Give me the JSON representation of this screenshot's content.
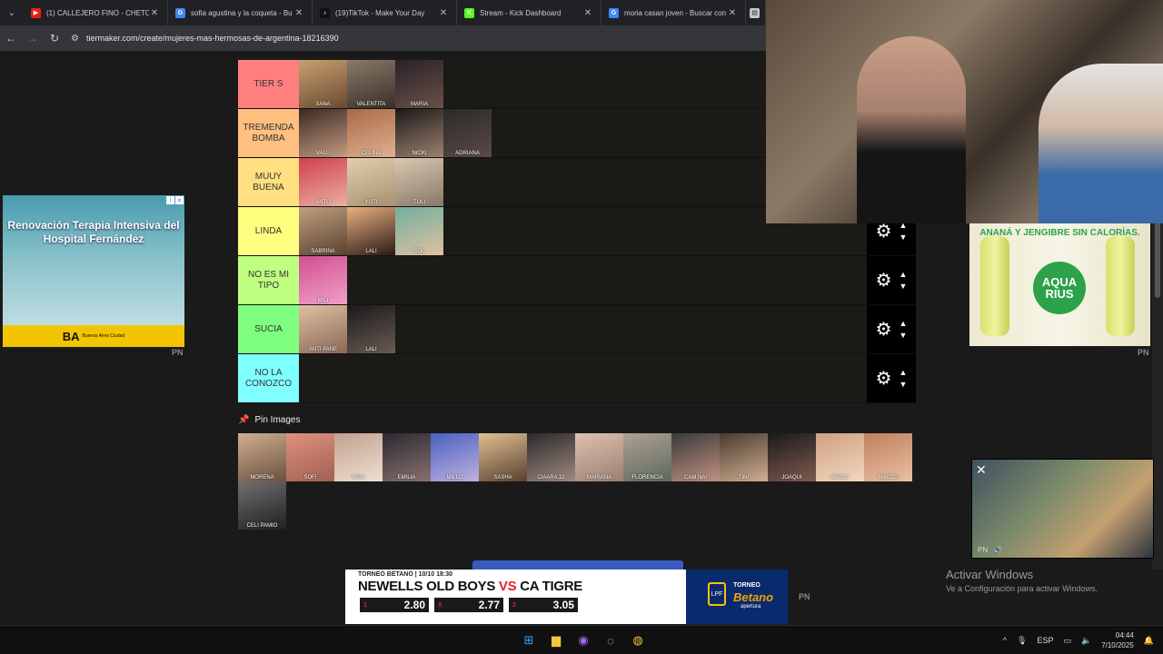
{
  "browser": {
    "tabs": [
      {
        "title": "(1) CALLEJERO FINO - CHETO",
        "color": "#e62117",
        "glyph": "▶"
      },
      {
        "title": "sofia agustina y la coqueta - Bu",
        "color": "#4285f4",
        "glyph": "G"
      },
      {
        "title": "(19)TikTok - Make Your Day",
        "color": "#111111",
        "glyph": "♪"
      },
      {
        "title": "Stream - Kick Dashboard",
        "color": "#53fc18",
        "glyph": "K"
      },
      {
        "title": "moria casan joven - Buscar con",
        "color": "#4285f4",
        "glyph": "G"
      }
    ],
    "url": "tiermaker.com/create/mujeres-mas-hermosas-de-argentina-18216390"
  },
  "tiers": [
    {
      "label": "TIER S",
      "color": "#ff7f7f",
      "items": [
        {
          "cap": "SANA",
          "c1": "#c8a070",
          "c2": "#6a4a30"
        },
        {
          "cap": "VALENTITA",
          "c1": "#8a7a6a",
          "c2": "#3a2e28"
        },
        {
          "cap": "MARIA",
          "c1": "#2a2228",
          "c2": "#6a5048"
        }
      ]
    },
    {
      "label": "TREMENDA BOMBA",
      "color": "#ffbf7f",
      "items": [
        {
          "cap": "VALU",
          "c1": "#3a2a24",
          "c2": "#c49a80"
        },
        {
          "cap": "CELINA",
          "c1": "#a86a48",
          "c2": "#e0b090"
        },
        {
          "cap": "NICKI",
          "c1": "#1a1a1a",
          "c2": "#a08070"
        },
        {
          "cap": "ADRIANA",
          "c1": "#2a2a2a",
          "c2": "#5a4a44"
        }
      ]
    },
    {
      "label": "MUUY BUENA",
      "color": "#ffdf7f",
      "items": [
        {
          "cap": "ANTO",
          "c1": "#d04050",
          "c2": "#e8b0a0"
        },
        {
          "cap": "YOTI",
          "c1": "#e0d0b0",
          "c2": "#a89070"
        },
        {
          "cap": "TULI",
          "c1": "#d8c8b0",
          "c2": "#8a7868"
        }
      ]
    },
    {
      "label": "LINDA",
      "color": "#ffff7f",
      "items": [
        {
          "cap": "SABRINA",
          "c1": "#c0a080",
          "c2": "#5a4030"
        },
        {
          "cap": "LALI",
          "c1": "#e8b080",
          "c2": "#2a1a14"
        },
        {
          "cap": "SOL",
          "c1": "#70b0a0",
          "c2": "#e0c0a0"
        }
      ]
    },
    {
      "label": "NO ES MI TIPO",
      "color": "#bfff7f",
      "items": [
        {
          "cap": "MILI",
          "c1": "#d05090",
          "c2": "#f0a0c8"
        }
      ]
    },
    {
      "label": "SUCIA",
      "color": "#7fff7f",
      "items": [
        {
          "cap": "ANTI PANE",
          "c1": "#e0c0a0",
          "c2": "#8a6858"
        },
        {
          "cap": "LALI",
          "c1": "#1a1a1a",
          "c2": "#6a5a54"
        }
      ]
    },
    {
      "label": "NO LA CONOZCO",
      "color": "#7fffff",
      "items": []
    }
  ],
  "pin": {
    "title": "Pin Images",
    "items": [
      {
        "cap": "MORENA",
        "c1": "#d0b090",
        "c2": "#6a5040"
      },
      {
        "cap": "SOFI",
        "c1": "#e09080",
        "c2": "#a06050"
      },
      {
        "cap": "IARA",
        "c1": "#c0a090",
        "c2": "#f0e0d0"
      },
      {
        "cap": "EMILIA",
        "c1": "#2a2a30",
        "c2": "#8a7070"
      },
      {
        "cap": "MILLO",
        "c1": "#4a60c0",
        "c2": "#c0b0e0"
      },
      {
        "cap": "SASHA",
        "c1": "#e0c090",
        "c2": "#5a4030"
      },
      {
        "cap": "CIAARA 22",
        "c1": "#2a2a2a",
        "c2": "#a08880"
      },
      {
        "cap": "MARIANA",
        "c1": "#e0c0b0",
        "c2": "#9a8070"
      },
      {
        "cap": "FLORENCIA",
        "c1": "#b0a090",
        "c2": "#5a6a60"
      },
      {
        "cap": "CAM NAI",
        "c1": "#3a3a3a",
        "c2": "#c09080"
      },
      {
        "cap": "TINI",
        "c1": "#4a3a30",
        "c2": "#d0b090"
      },
      {
        "cap": "JOAQUI",
        "c1": "#1a1a1a",
        "c2": "#805a50"
      },
      {
        "cap": "MAGUI",
        "c1": "#d0a080",
        "c2": "#f0d8c0"
      },
      {
        "cap": "MACCO",
        "c1": "#c08060",
        "c2": "#e8c0a0"
      },
      {
        "cap": "CELI PAMIO",
        "c1": "#707070",
        "c2": "#202020"
      }
    ]
  },
  "ads": {
    "left_headline": "Renovación Terapia Intensiva del Hospital Fernández",
    "left_brand": "BA",
    "left_brand_sub": "Buenos Aires Ciudad",
    "pn": "PN",
    "right_headline": "ANANÁ Y JENGIBRE SIN CALORÍAS.",
    "right_logo": "AQUA RIUS",
    "bottom_tag": "TORNEO BETANO | 10/10 18:30",
    "bottom_team1": "NEWELLS OLD BOYS",
    "bottom_vs": "VS",
    "bottom_team2": "CA TIGRE",
    "bottom_odds": [
      {
        "k": "1",
        "v": "2.80"
      },
      {
        "k": "X",
        "v": "2.77"
      },
      {
        "k": "2",
        "v": "3.05"
      }
    ],
    "bottom_torneo": "TORNEO",
    "bottom_betano": "Betano",
    "bottom_apertura": "apertura"
  },
  "windows": {
    "activate_title": "Activar Windows",
    "activate_sub": "Ve a Configuración para activar Windows.",
    "lang": "ESP",
    "time": "04:44",
    "date": "7/10/2025"
  }
}
